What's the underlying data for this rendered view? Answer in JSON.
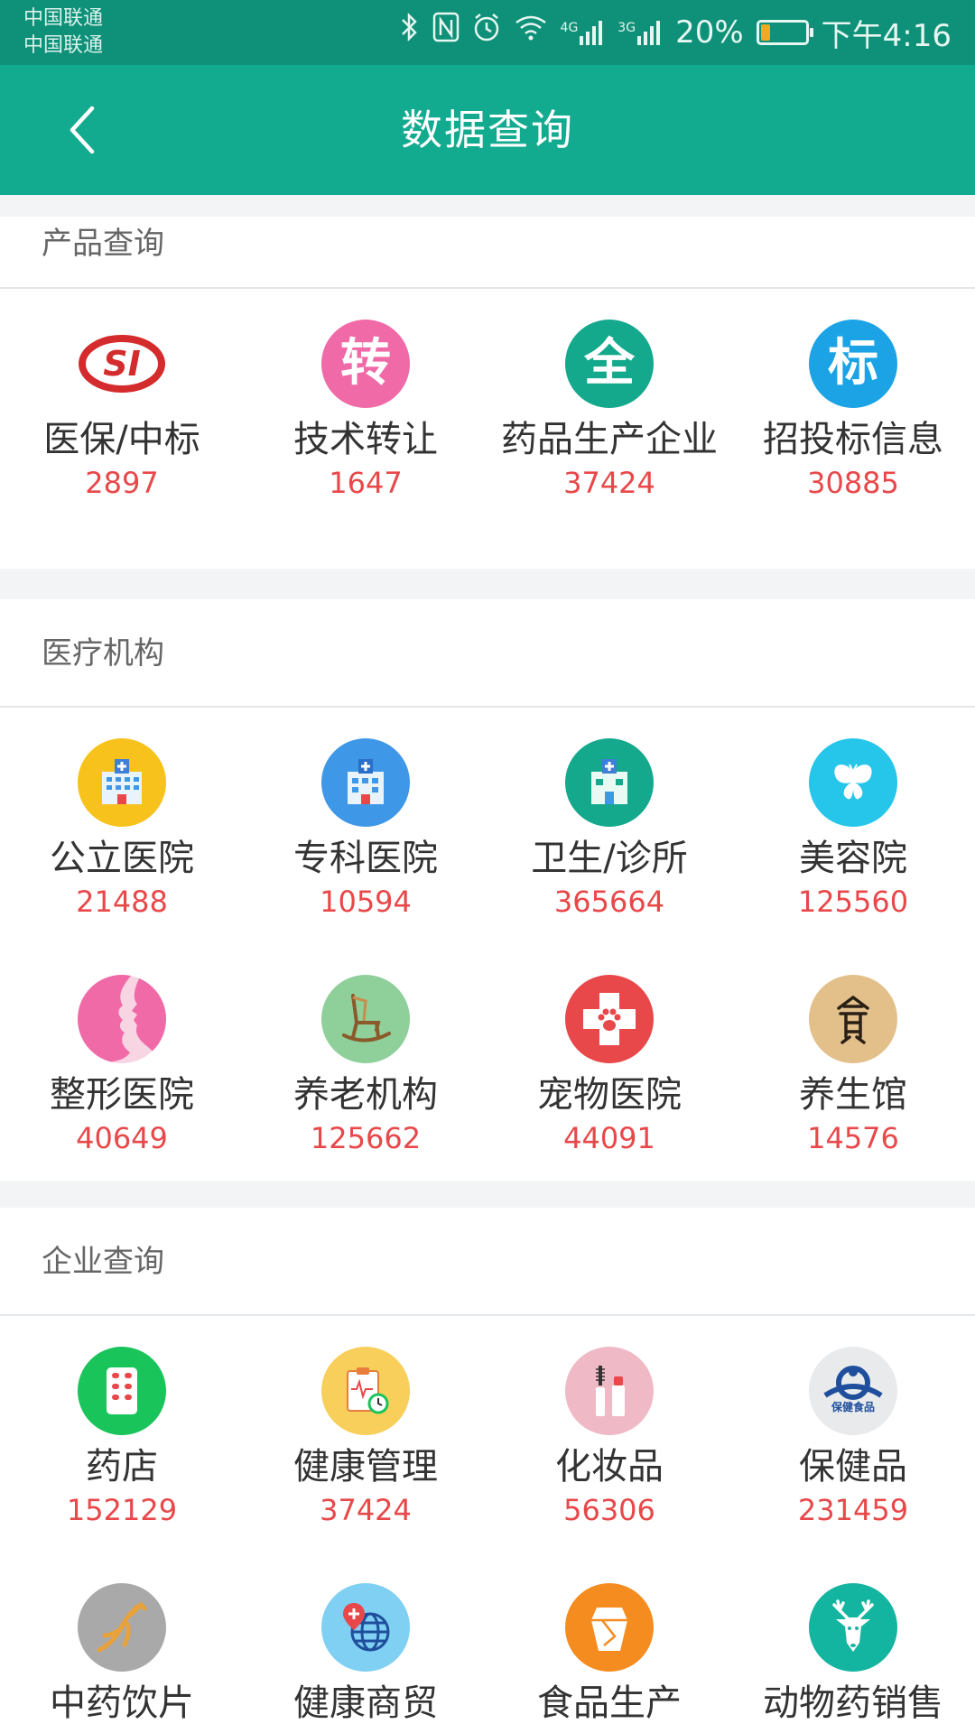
{
  "status_bar": {
    "carrier_1": "中国联通",
    "carrier_2": "中国联通",
    "network_4g": "4G",
    "network_3g": "3G",
    "battery_percent": "20%",
    "battery_level": 0.2,
    "time": "下午4:16"
  },
  "app_bar": {
    "title": "数据查询",
    "back_icon": "chevron-left-icon"
  },
  "colors": {
    "primary": "#13ab90",
    "status_bar": "#0f9078",
    "count_red": "#e8484a"
  },
  "sections": [
    {
      "title": "产品查询",
      "items": [
        {
          "label": "医保/中标",
          "count": "2897",
          "icon": "si-logo-icon",
          "glyph": "SI",
          "color": "#ffffff"
        },
        {
          "label": "技术转让",
          "count": "1647",
          "icon": "transfer-icon",
          "glyph": "转",
          "color": "#f06aa7"
        },
        {
          "label": "药品生产企业",
          "count": "37424",
          "icon": "all-icon",
          "glyph": "全",
          "color": "#14a98d"
        },
        {
          "label": "招投标信息",
          "count": "30885",
          "icon": "bid-icon",
          "glyph": "标",
          "color": "#1ba3e6"
        }
      ]
    },
    {
      "title": "医疗机构",
      "items": [
        {
          "label": "公立医院",
          "count": "21488",
          "icon": "public-hospital-icon",
          "color": "#f7c21b"
        },
        {
          "label": "专科医院",
          "count": "10594",
          "icon": "specialist-hospital-icon",
          "color": "#3f97e8"
        },
        {
          "label": "卫生/诊所",
          "count": "365664",
          "icon": "clinic-icon",
          "color": "#14a98d"
        },
        {
          "label": "美容院",
          "count": "125560",
          "icon": "butterfly-icon",
          "color": "#25c6ea"
        },
        {
          "label": "整形医院",
          "count": "40649",
          "icon": "face-profile-icon",
          "color": "#f06aa7"
        },
        {
          "label": "养老机构",
          "count": "125662",
          "icon": "rocking-chair-icon",
          "color": "#8fcf9a"
        },
        {
          "label": "宠物医院",
          "count": "44091",
          "icon": "pet-cross-icon",
          "color": "#e8484a"
        },
        {
          "label": "养生馆",
          "count": "14576",
          "icon": "seal-character-icon",
          "color": "#e3c08a"
        }
      ]
    },
    {
      "title": "企业查询",
      "items": [
        {
          "label": "药店",
          "count": "152129",
          "icon": "pill-pack-icon",
          "color": "#19c45b"
        },
        {
          "label": "健康管理",
          "count": "37424",
          "icon": "health-clipboard-icon",
          "color": "#f7cf5a"
        },
        {
          "label": "化妆品",
          "count": "56306",
          "icon": "cosmetics-icon",
          "color": "#f0b9c6"
        },
        {
          "label": "保健品",
          "count": "231459",
          "icon": "health-food-logo-icon",
          "color": "#e9eaec",
          "logo_text": "保健食品"
        },
        {
          "label": "中药饮片",
          "count": "",
          "icon": "ginseng-icon",
          "color": "#a9a9a9"
        },
        {
          "label": "健康商贸",
          "count": "",
          "icon": "globe-pin-icon",
          "color": "#7fd0f2"
        },
        {
          "label": "食品生产",
          "count": "",
          "icon": "food-box-icon",
          "color": "#f58c1f"
        },
        {
          "label": "动物药销售",
          "count": "",
          "icon": "deer-icon",
          "color": "#14b5a0"
        }
      ]
    }
  ]
}
